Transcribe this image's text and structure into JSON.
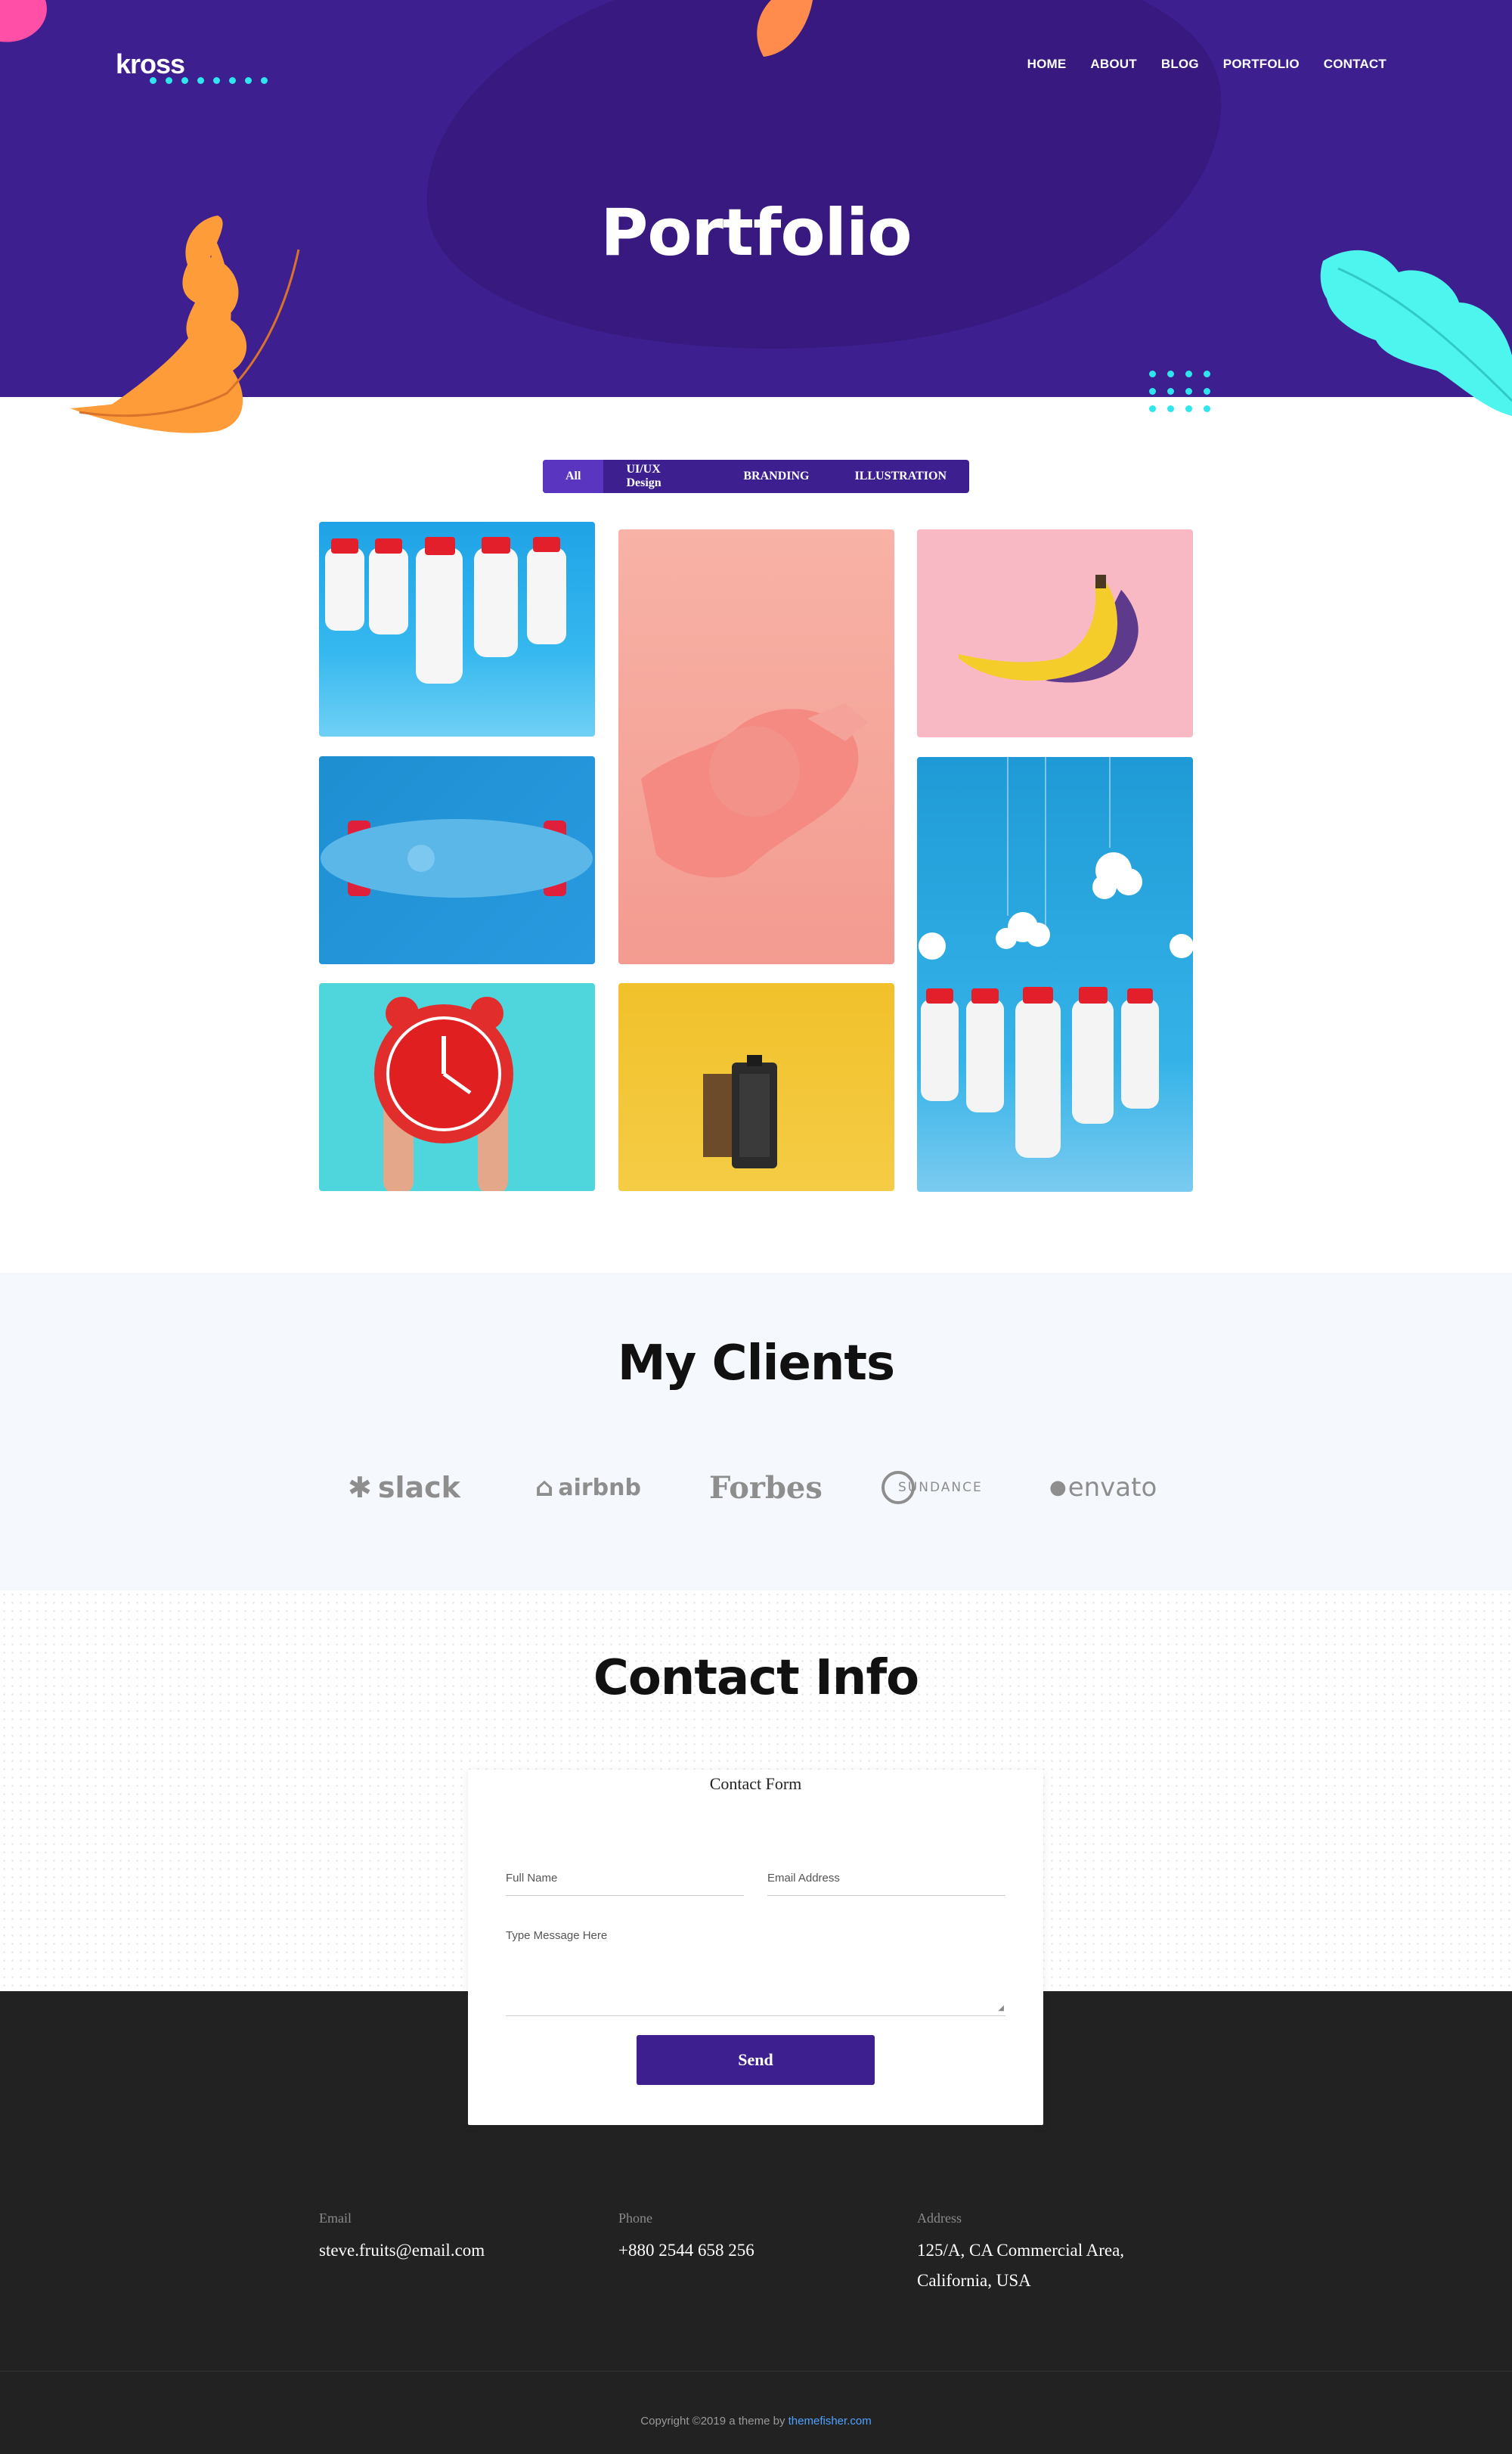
{
  "header": {
    "logo": "kross",
    "nav": [
      "HOME",
      "ABOUT",
      "BLOG",
      "PORTFOLIO",
      "CONTACT"
    ],
    "title": "Portfolio"
  },
  "filter": {
    "tabs": [
      "All",
      "UI/UX Design",
      "BRANDING",
      "ILLUSTRATION"
    ],
    "active": "All"
  },
  "gallery": {
    "items": [
      "milk-bottles",
      "pink-glove",
      "banana",
      "skateboard",
      "bottles-clouds",
      "alarm-clock",
      "film-roll"
    ]
  },
  "clients": {
    "title": "My Clients",
    "logos": [
      "slack",
      "airbnb",
      "Forbes",
      "SUNDANCE",
      "envato"
    ]
  },
  "contact": {
    "title": "Contact Info",
    "form_title": "Contact Form",
    "name_placeholder": "Full Name",
    "email_placeholder": "Email Address",
    "message_placeholder": "Type Message Here",
    "send_label": "Send"
  },
  "footer": {
    "email_label": "Email",
    "email_value": "steve.fruits@email.com",
    "phone_label": "Phone",
    "phone_value": "+880 2544 658 256",
    "address_label": "Address",
    "address_line1": "125/A, CA Commercial Area,",
    "address_line2": "California, USA",
    "copyright": "Copyright ©2019 a theme by",
    "copyright_link": "themefisher.com"
  },
  "colors": {
    "brand": "#3e1f8f",
    "accent": "#2fe6ee",
    "orange": "#ff9c3a",
    "footer": "#222222"
  }
}
